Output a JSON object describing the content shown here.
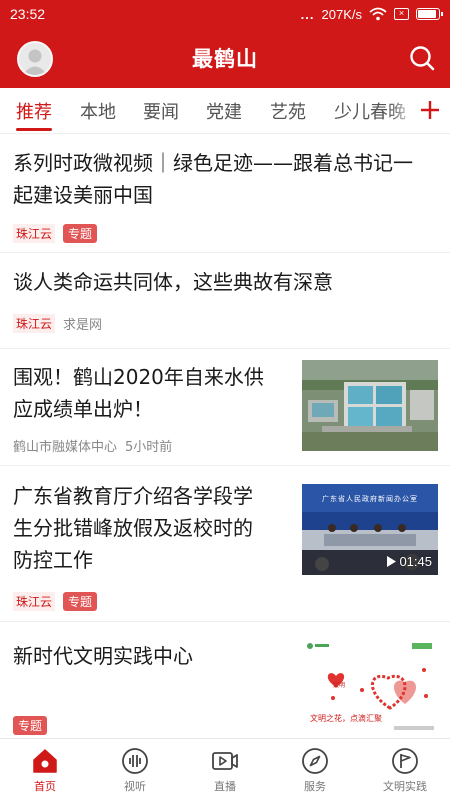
{
  "status_bar": {
    "time": "23:52",
    "dots": "...",
    "speed": "207K/s"
  },
  "header": {
    "title": "最鹤山"
  },
  "tabs": [
    {
      "label": "推荐"
    },
    {
      "label": "本地"
    },
    {
      "label": "要闻"
    },
    {
      "label": "党建"
    },
    {
      "label": "艺苑"
    },
    {
      "label": "少儿春晚"
    }
  ],
  "feed": [
    {
      "title_line1": "系列时政微视频｜绿色足迹——跟着总书记一",
      "title_line2": "起建设美丽中国",
      "source": "珠江云",
      "tag": "专题"
    },
    {
      "title_line1": "谈人类命运共同体，这些典故有深意",
      "source": "珠江云",
      "outlet": "求是网"
    },
    {
      "title_line1": "围观！鹤山2020年自来水供",
      "title_line2": "应成绩单出炉！",
      "source": "鹤山市融媒体中心",
      "time": "5小时前"
    },
    {
      "title_line1": "广东省教育厅介绍各学段学",
      "title_line2": "生分批错峰放假及返校时的",
      "title_line3": "防控工作",
      "source": "珠江云",
      "tag": "专题",
      "thumb_caption": "广东省人民政府新闻办公室",
      "duration": "01:45"
    },
    {
      "title_line1": "新时代文明实践中心",
      "tag": "专题",
      "thumb_caption": "文明之花，点滴汇聚",
      "thumb_heart_label": "文明"
    }
  ],
  "bottom_nav": [
    {
      "label": "首页",
      "icon": "home-icon",
      "active": true
    },
    {
      "label": "视听",
      "icon": "audio-wave-icon"
    },
    {
      "label": "直播",
      "icon": "live-camera-icon"
    },
    {
      "label": "服务",
      "icon": "compass-icon"
    },
    {
      "label": "文明实践",
      "icon": "flag-icon"
    }
  ],
  "colors": {
    "brand": "#d01818",
    "tag_bg": "#e25555",
    "text": "#1a1a1a",
    "meta": "#888888"
  }
}
